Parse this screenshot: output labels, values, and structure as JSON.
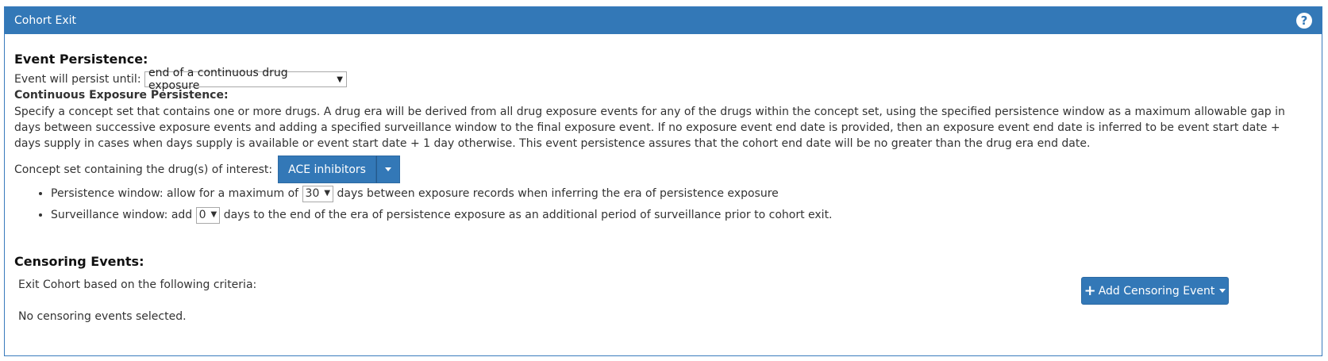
{
  "panel": {
    "title": "Cohort Exit",
    "help_icon": "question-circle-icon",
    "help_glyph": "?"
  },
  "event_persistence": {
    "heading": "Event Persistence:",
    "persist_label": "Event will persist until:",
    "persist_value": "end of a continuous drug exposure",
    "sub_heading": "Continuous Exposure Persistence:",
    "description": "Specify a concept set that contains one or more drugs. A drug era will be derived from all drug exposure events for any of the drugs within the concept set, using the specified persistence window as a maximum allowable gap in days between successive exposure events and adding a specified surveillance window to the final exposure event. If no exposure event end date is provided, then an exposure event end date is inferred to be event start date + days supply in cases when days supply is available or event start date + 1 day otherwise. This event persistence assures that the cohort end date will be no greater than the drug era end date.",
    "concept_label": "Concept set containing the drug(s) of interest:",
    "concept_value": "ACE inhibitors",
    "persistence_prefix": "Persistence window: allow for a maximum of",
    "persistence_value": "30",
    "persistence_suffix": "days between exposure records when inferring the era of persistence exposure",
    "surveillance_prefix": "Surveillance window: add",
    "surveillance_value": "0",
    "surveillance_suffix": "days to the end of the era of persistence exposure as an additional period of surveillance prior to cohort exit."
  },
  "censoring": {
    "heading": "Censoring Events:",
    "criteria_text": "Exit Cohort based on the following criteria:",
    "empty_text": "No censoring events selected.",
    "add_button_label": "Add Censoring Event",
    "add_icon": "plus-icon",
    "add_glyph": "+"
  },
  "colors": {
    "header_bg": "#3378b7",
    "primary_button": "#3378b7"
  }
}
